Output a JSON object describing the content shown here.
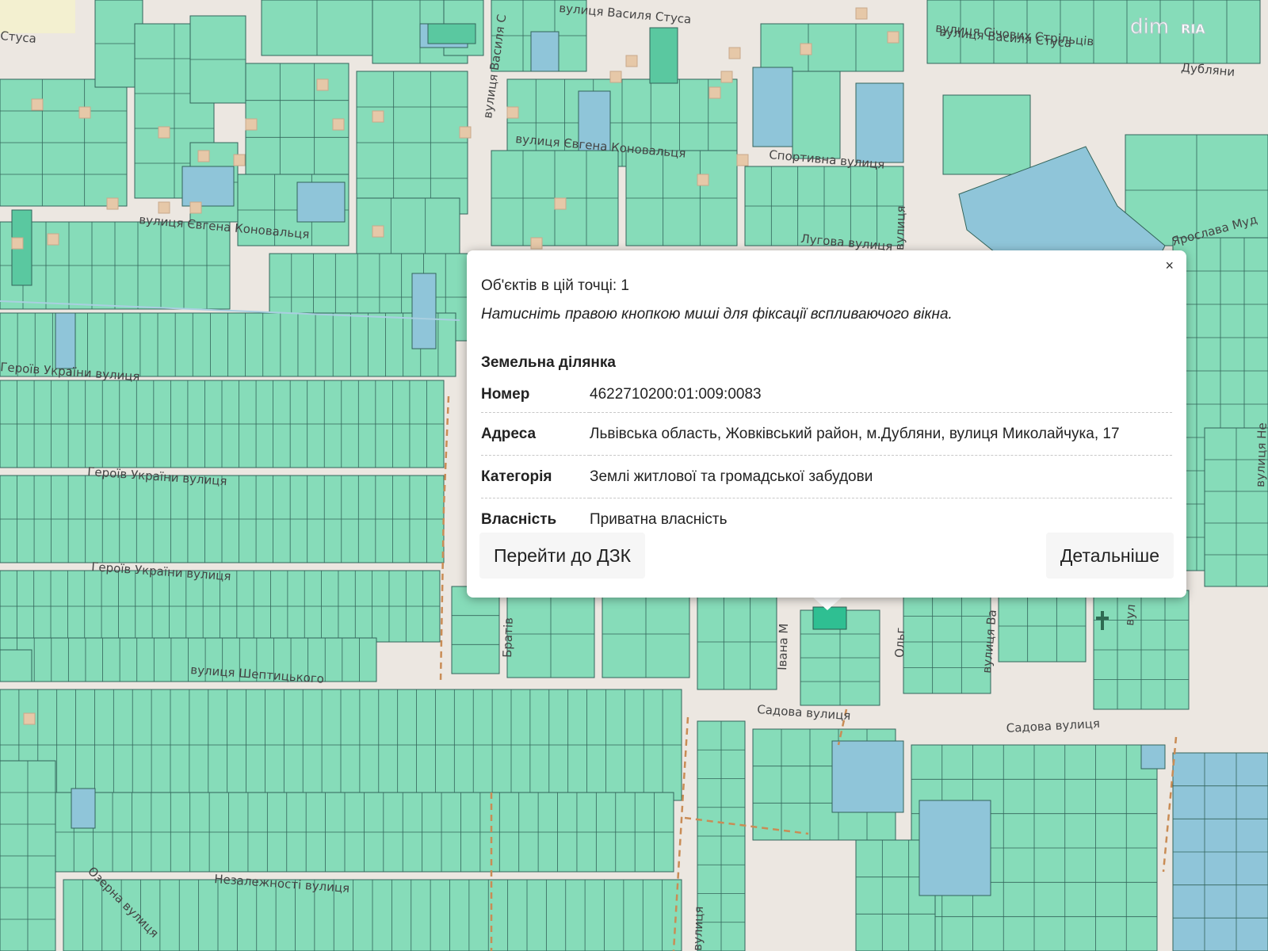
{
  "map": {
    "street_labels": [
      "вулиця Василя Стуса",
      "Стуса",
      "вулиця Василя Стуса",
      "вулиця Василя С",
      "вулиця Січових Стрільців",
      "Дубляни",
      "вулиця Євгена Коновальця",
      "Спортивна вулиця",
      "вулиця Євгена Коновальця",
      "Лугова вулиця",
      "вулиця",
      "Ярослава Муд",
      "Героїв України вулиця",
      "Героїв України вулиця",
      "Героїв України вулиця",
      "вулиця Шептицького",
      "Садова вулиця",
      "Садова вулиця",
      "Незалежності вулиця",
      "Озерна вулиця",
      "вулиця",
      "Братів",
      "Івана М",
      "Ольг",
      "вулиця Ва",
      "вулиця Не",
      "вул"
    ]
  },
  "popup": {
    "close_symbol": "×",
    "objects_count_text": "Об'єктів в цій точці: 1",
    "hint_text": "Натисніть правою кнопкою миші для фіксації вспливаючого вікна.",
    "section_title": "Земельна ділянка",
    "rows": [
      {
        "key": "Номер",
        "value": "4622710200:01:009:0083"
      },
      {
        "key": "Адреса",
        "value": "Львівська область, Жовківський район, м.Дубляни, вулиця Миколайчука, 17"
      },
      {
        "key": "Категорія",
        "value": "Землі житлової та громадської забудови"
      },
      {
        "key": "Власність",
        "value": "Приватна власність"
      }
    ],
    "button_left": "Перейти до ДЗК",
    "button_right": "Детальніше"
  },
  "watermark": {
    "text": "dim",
    "ria": "RIA"
  },
  "colors": {
    "parcel": "#86dcb9",
    "parcel_stroke": "#33645a",
    "parcel_blue": "#8fc5d9",
    "parcel_dark": "#5ac8a0",
    "road": "#ffffff",
    "background": "#ece7e1",
    "building": "#e6c8a8",
    "boundary": "#c98c55"
  }
}
